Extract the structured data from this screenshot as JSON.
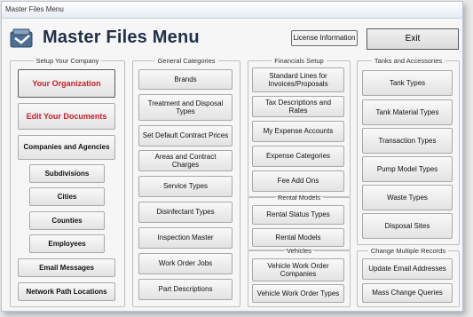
{
  "window": {
    "title": "Master Files Menu"
  },
  "header": {
    "title": "Master Files Menu",
    "license_label": "License Information",
    "exit_label": "Exit"
  },
  "groups": {
    "setup": {
      "legend": "Setup Your Company",
      "buttons": {
        "organization": "Your Organization",
        "documents": "Edit Your Documents",
        "companies": "Companies and Agencies",
        "subdivisions": "Subdivisions",
        "cities": "Cities",
        "counties": "Counties",
        "employees": "Employees",
        "email_messages": "Email Messages",
        "network_paths": "Network Path Locations"
      }
    },
    "general": {
      "legend": "General Categories",
      "buttons": {
        "brands": "Brands",
        "treatment": "Treatment and Disposal Types",
        "default_prices": "Set Default Contract Prices",
        "areas": "Areas and Contract Charges",
        "service_types": "Service Types",
        "disinfectant": "Disinfectant Types",
        "inspection": "Inspection Master",
        "work_order_jobs": "Work Order Jobs",
        "part_descriptions": "Part Descriptions"
      }
    },
    "financials": {
      "legend": "Financials Setup",
      "buttons": {
        "standard_lines": "Standard Lines for Invoices/Proposals",
        "tax": "Tax Descriptions and Rates",
        "expense_accounts": "My Expense Accounts",
        "expense_categories": "Expense Categories",
        "fee_add_ons": "Fee Add Ons"
      }
    },
    "rental": {
      "legend": "Rental Models",
      "buttons": {
        "rental_status": "Rental Status Types",
        "rental_models": "Rental Models"
      }
    },
    "vehicles": {
      "legend": "Vehicles",
      "buttons": {
        "vehicle_wo_companies": "Vehicle Work Order Companies",
        "vehicle_wo_types": "Vehicle Work Order Types"
      }
    },
    "tanks": {
      "legend": "Tanks and Accessories",
      "buttons": {
        "tank_types": "Tank Types",
        "tank_material": "Tank Material Types",
        "transaction_types": "Transaction Types",
        "pump_model": "Pump Model Types",
        "waste_types": "Waste Types",
        "disposal_sites": "Disposal Sites"
      }
    },
    "change": {
      "legend": "Change Multiple Records",
      "buttons": {
        "update_email": "Update Email Addresses",
        "mass_change": "Mass Change Queries"
      }
    }
  },
  "colors": {
    "accent_red": "#c8202a",
    "title_navy": "#22304a"
  }
}
